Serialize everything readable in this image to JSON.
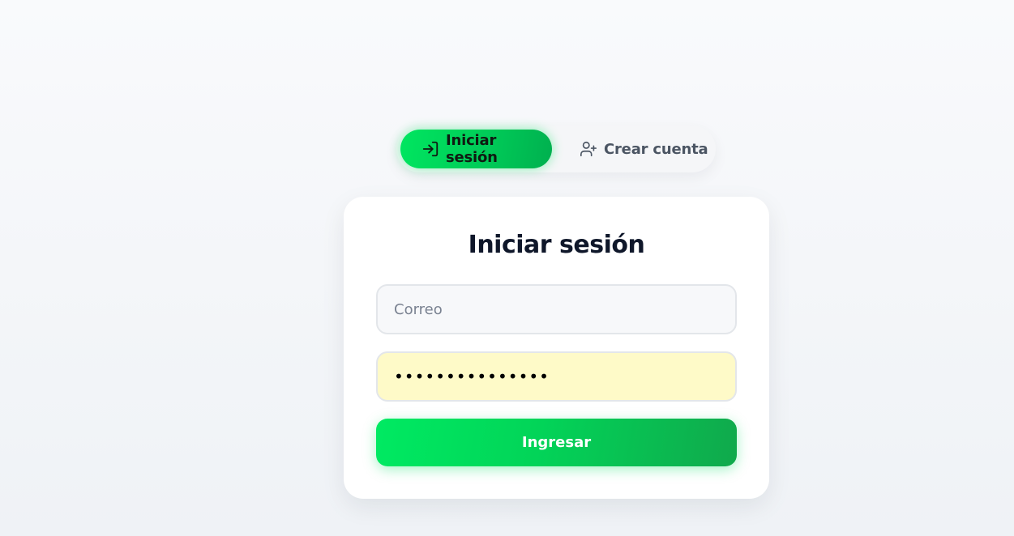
{
  "tabs": {
    "login": {
      "label": "Iniciar sesión",
      "icon": "log-in-icon",
      "active": true
    },
    "register": {
      "label": "Crear cuenta",
      "icon": "user-plus-icon",
      "active": false
    }
  },
  "form": {
    "title": "Iniciar sesión",
    "email": {
      "placeholder": "Correo",
      "value": ""
    },
    "password": {
      "value": "•••••••••••••••"
    },
    "submit_label": "Ingresar"
  },
  "colors": {
    "accent": "#00e660",
    "accent_dark": "#10a94c",
    "autofill_bg": "#fefac8",
    "title": "#0f172a"
  }
}
